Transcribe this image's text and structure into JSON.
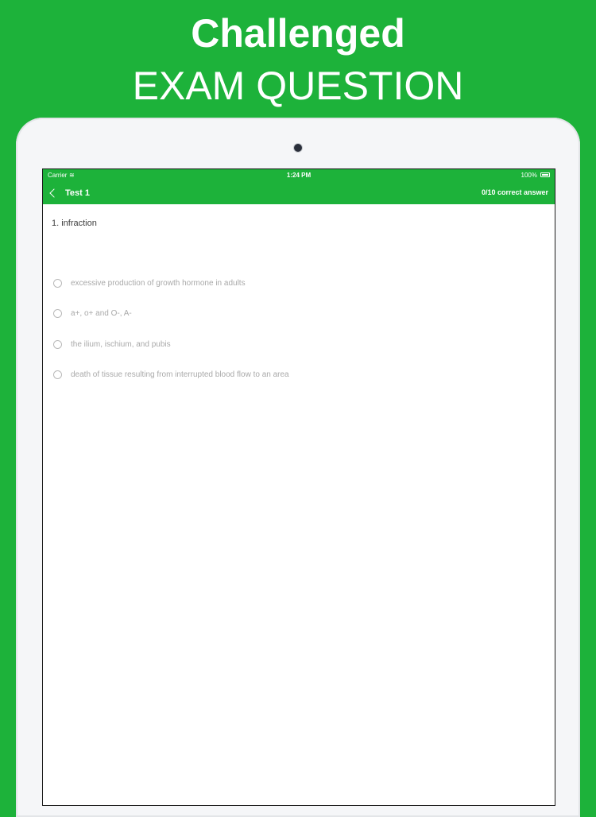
{
  "promo": {
    "line1": "Challenged",
    "line2": "EXAM QUESTION"
  },
  "status_bar": {
    "carrier": "Carrier",
    "time": "1:24 PM",
    "battery": "100%"
  },
  "nav": {
    "title": "Test 1",
    "score": "0/10 correct answer"
  },
  "question": {
    "text": "1. infraction"
  },
  "answers": [
    {
      "label": "excessive production of growth hormone in adults"
    },
    {
      "label": "a+, o+ and O-, A-"
    },
    {
      "label": "the ilium, ischium, and pubis"
    },
    {
      "label": "death of tissue resulting from interrupted blood flow to an area"
    }
  ],
  "colors": {
    "accent": "#1db23a"
  },
  "icons": [
    "wifi-icon",
    "battery-icon",
    "back-chevron-icon",
    "radio-icon"
  ]
}
